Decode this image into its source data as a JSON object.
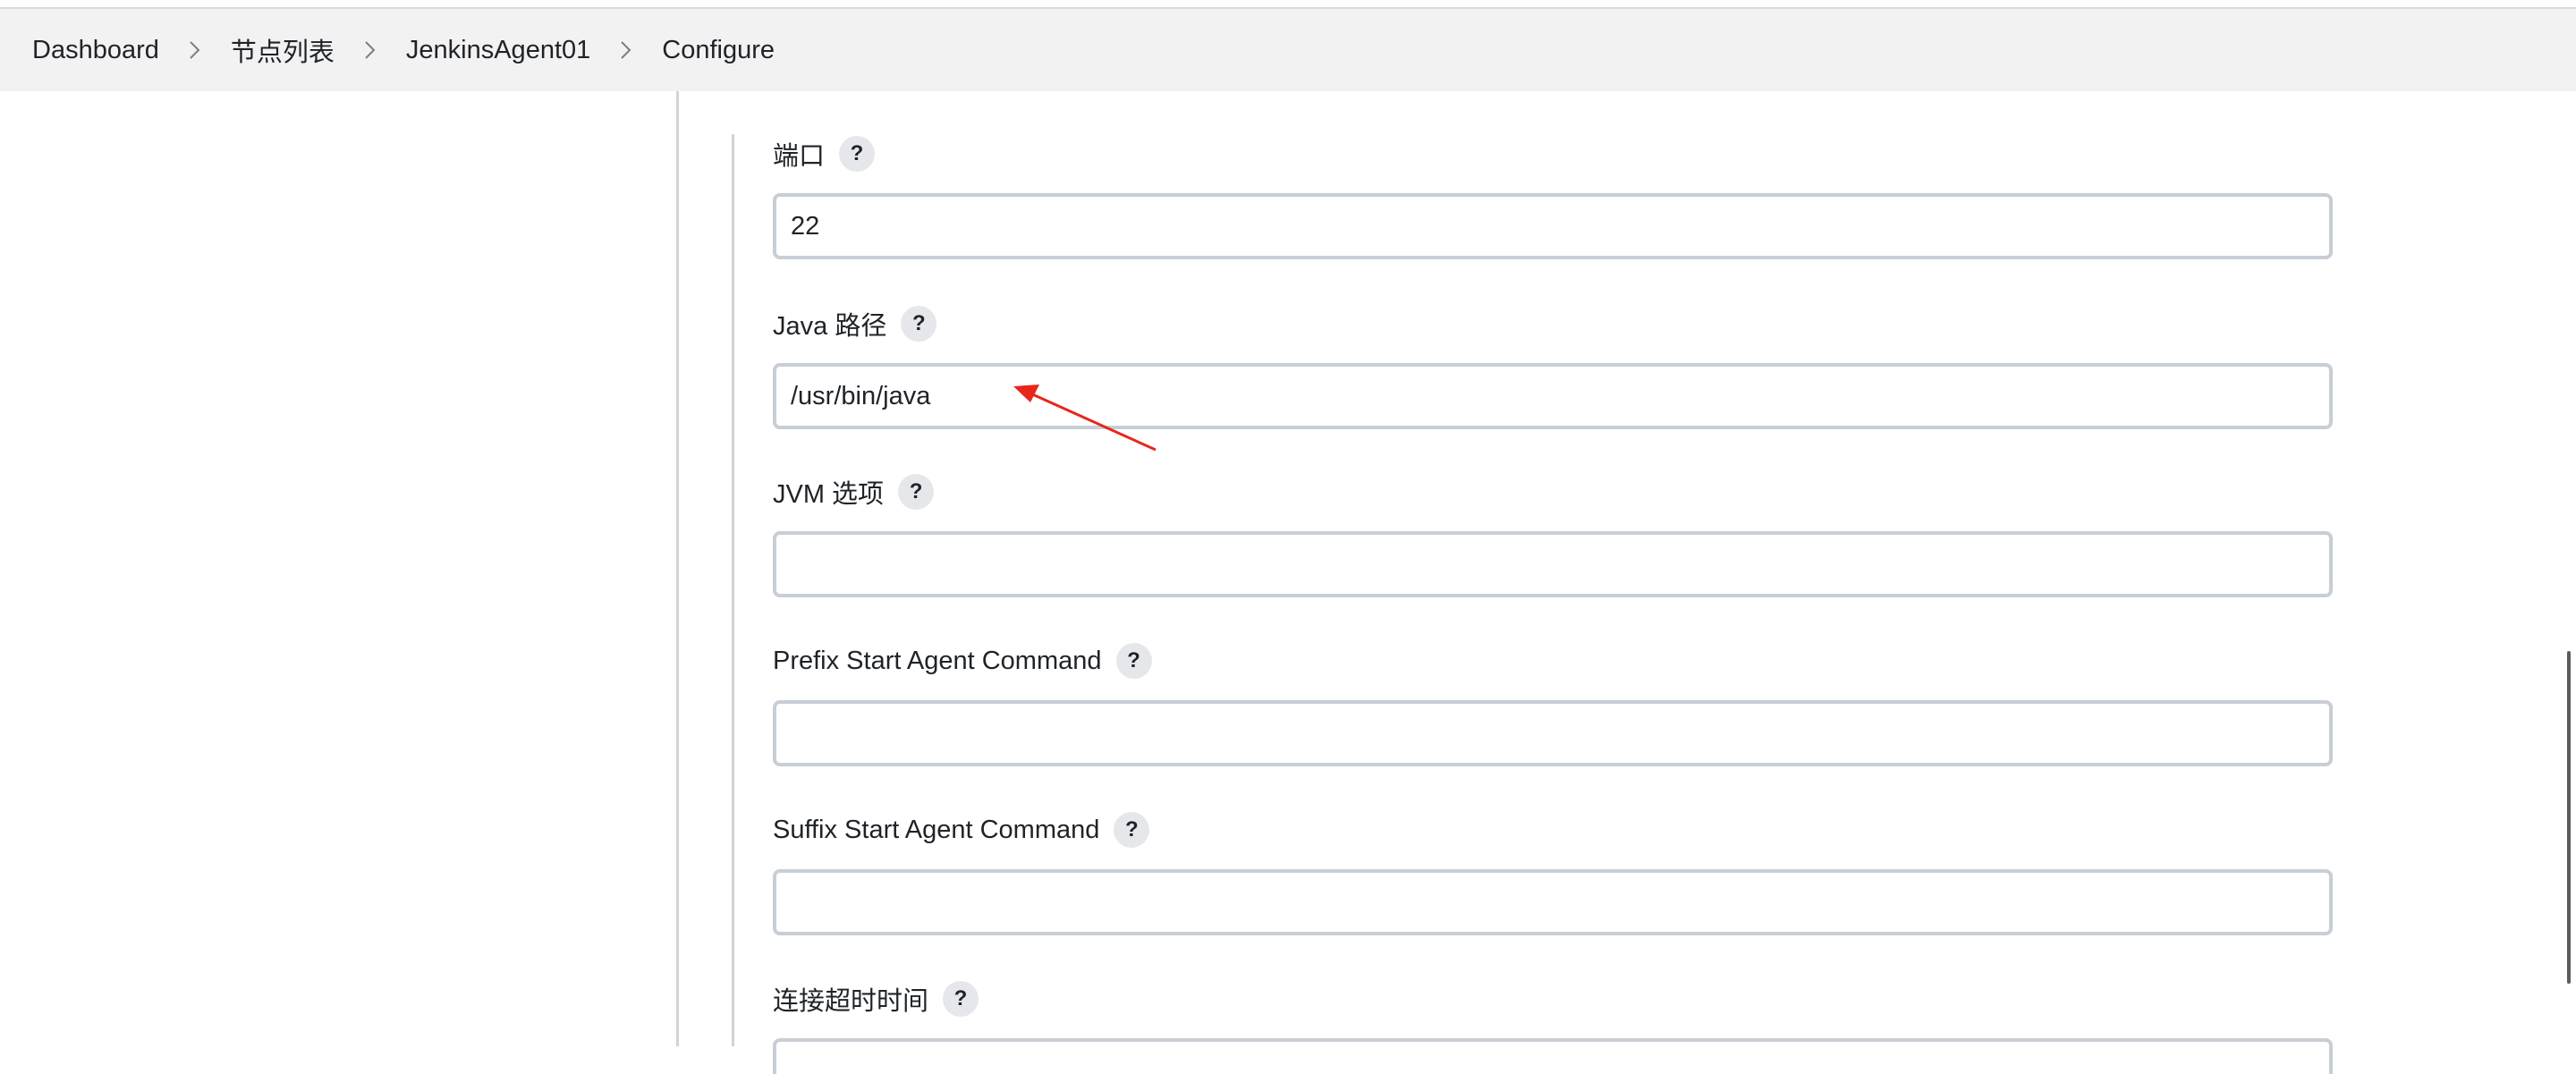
{
  "breadcrumb": {
    "items": [
      {
        "label": "Dashboard"
      },
      {
        "label": "节点列表"
      },
      {
        "label": "JenkinsAgent01"
      },
      {
        "label": "Configure"
      }
    ],
    "separator_icon": "chevron-right-icon"
  },
  "form": {
    "help_label": "?",
    "fields": [
      {
        "label": "端口",
        "value": "22"
      },
      {
        "label": "Java 路径",
        "value": "/usr/bin/java"
      },
      {
        "label": "JVM 选项",
        "value": ""
      },
      {
        "label": "Prefix Start Agent Command",
        "value": ""
      },
      {
        "label": "Suffix Start Agent Command",
        "value": ""
      },
      {
        "label": "连接超时时间",
        "value": ""
      }
    ]
  },
  "annotation": {
    "type": "red-arrow",
    "color": "#e8261c",
    "points_to": "Java 路径"
  }
}
